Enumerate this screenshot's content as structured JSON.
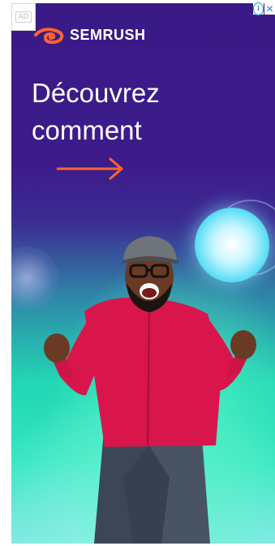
{
  "ad": {
    "badge_label": "AD",
    "brand": "SEMRUSH",
    "headline_line1": "Découvrez",
    "headline_line2": "comment",
    "icons": {
      "logo": "semrush-flame-icon",
      "arrow": "arrow-right-icon",
      "info": "info-icon",
      "close": "close-icon"
    },
    "colors": {
      "purple": "#3a1a86",
      "teal": "#22d6b4",
      "accent_orange": "#ff642d",
      "shirt_red": "#d8164c"
    }
  }
}
